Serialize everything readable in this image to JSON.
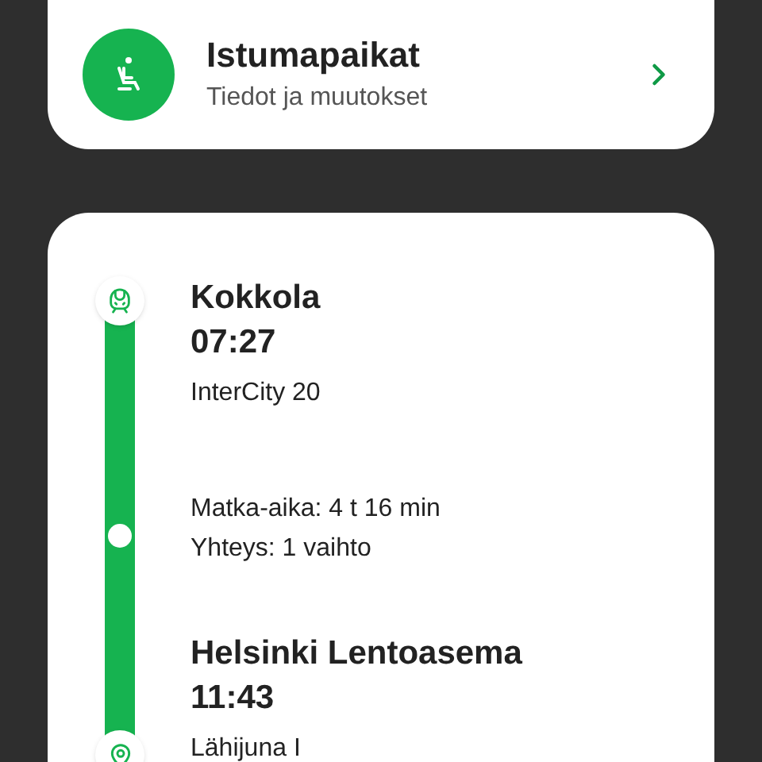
{
  "seats_card": {
    "title": "Istumapaikat",
    "subtitle": "Tiedot ja muutokset"
  },
  "journey": {
    "stops": [
      {
        "kind": "departure",
        "station": "Kokkola",
        "time": "07:27",
        "train": "InterCity 20"
      },
      {
        "kind": "summary",
        "lines": [
          "Matka-aika: 4 t 16 min",
          "Yhteys: 1 vaihto"
        ]
      },
      {
        "kind": "arrival",
        "station": "Helsinki Lentoasema",
        "time": "11:43",
        "train": "Lähijuna I"
      }
    ]
  }
}
